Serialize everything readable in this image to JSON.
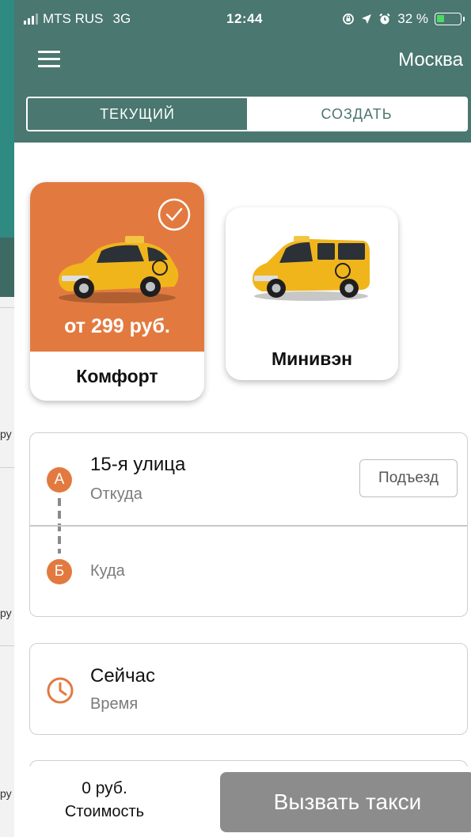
{
  "status_bar": {
    "carrier": "MTS RUS",
    "network": "3G",
    "time": "12:44",
    "battery": "32 %",
    "battery_level": 0.32
  },
  "header": {
    "city": "Москва"
  },
  "tabs": {
    "current": "ТЕКУЩИЙ",
    "create": "СОЗДАТЬ",
    "active": "current"
  },
  "tariffs": [
    {
      "name": "Комфорт",
      "price": "от 299 руб.",
      "selected": true
    },
    {
      "name": "Минивэн",
      "selected": false
    }
  ],
  "route": {
    "from_marker": "А",
    "from_address": "15-я улица",
    "from_label": "Откуда",
    "entrance_button": "Подъезд",
    "to_marker": "Б",
    "to_label": "Куда"
  },
  "time": {
    "value": "Сейчас",
    "label": "Время"
  },
  "bottom": {
    "cost_value": "0 руб.",
    "cost_label": "Стоимость",
    "call_button": "Вызвать такси"
  },
  "background_fragments": [
    "%",
    "ру",
    "ру",
    "ру"
  ],
  "colors": {
    "header": "#4a7770",
    "accent": "#e27a3f",
    "button_disabled": "#8c8c8c"
  }
}
